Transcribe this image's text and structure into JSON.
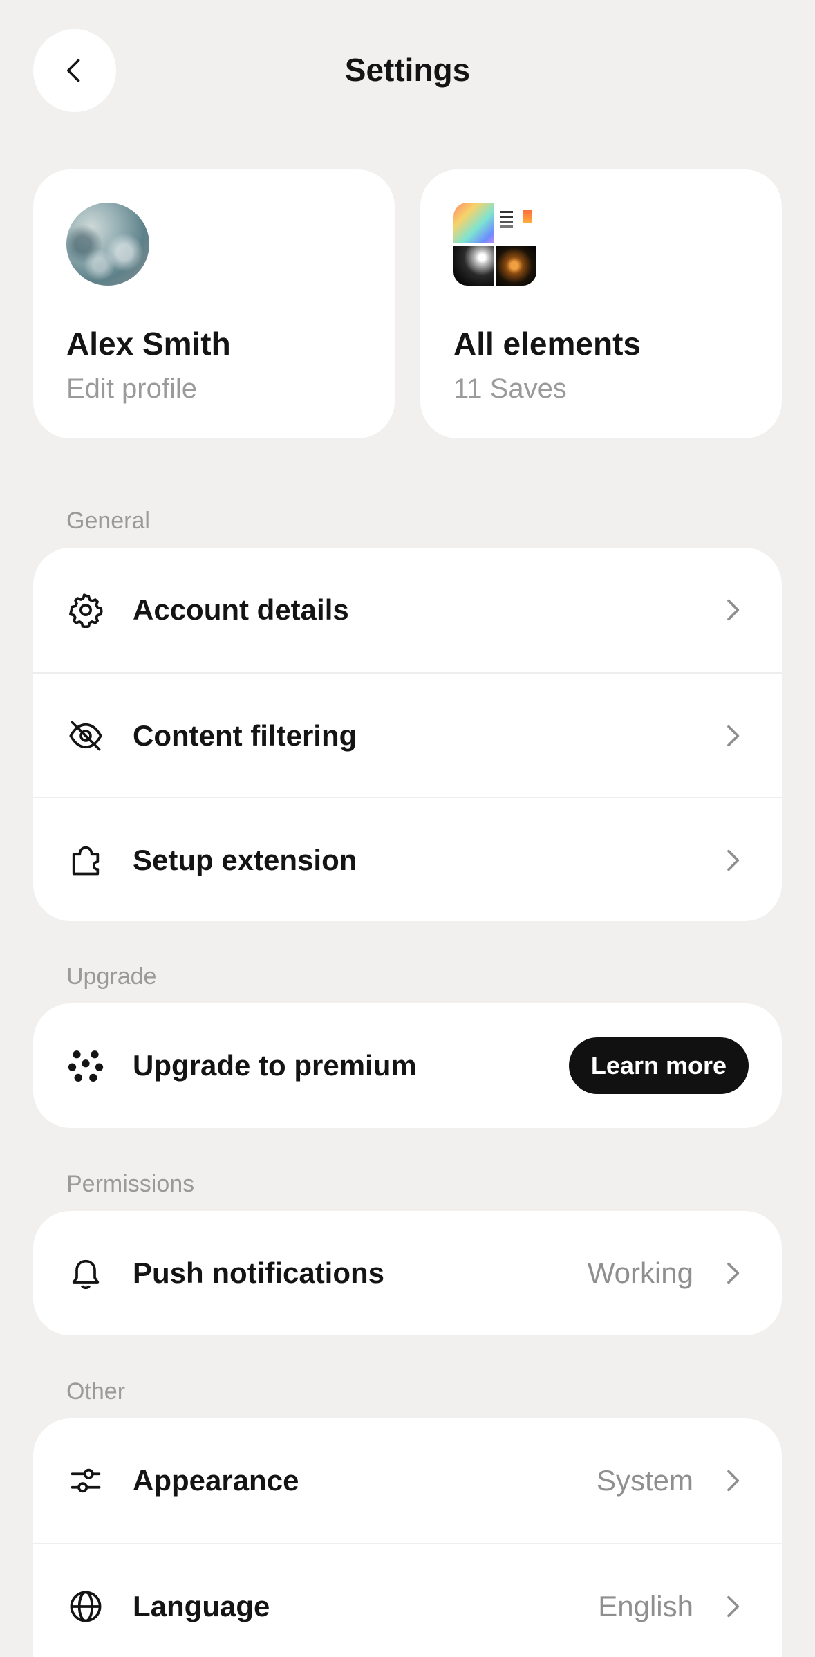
{
  "header": {
    "title": "Settings"
  },
  "profile_card": {
    "name": "Alex Smith",
    "subtitle": "Edit profile"
  },
  "saves_card": {
    "title": "All elements",
    "subtitle": "11 Saves"
  },
  "sections": {
    "general": {
      "label": "General",
      "items": [
        {
          "label": "Account details",
          "icon": "gear-icon"
        },
        {
          "label": "Content filtering",
          "icon": "eye-slash-icon"
        },
        {
          "label": "Setup extension",
          "icon": "puzzle-icon"
        }
      ]
    },
    "upgrade": {
      "label": "Upgrade",
      "item": {
        "label": "Upgrade to premium",
        "icon": "dots-flower-icon",
        "button": "Learn more"
      }
    },
    "permissions": {
      "label": "Permissions",
      "item": {
        "label": "Push notifications",
        "value": "Working",
        "icon": "bell-icon"
      }
    },
    "other": {
      "label": "Other",
      "items": [
        {
          "label": "Appearance",
          "value": "System",
          "icon": "sliders-icon"
        },
        {
          "label": "Language",
          "value": "English",
          "icon": "globe-icon"
        }
      ]
    }
  },
  "colors": {
    "background": "#f1f0ef",
    "card": "#ffffff",
    "button_bg": "#111111",
    "muted_text": "#9a9a9a"
  }
}
